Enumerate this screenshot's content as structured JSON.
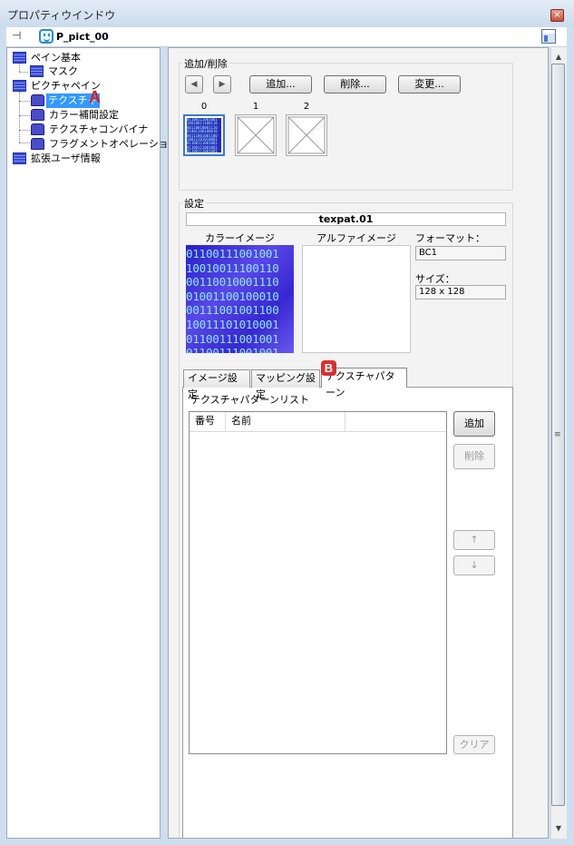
{
  "window": {
    "title": "プロパティウインドウ",
    "close_glyph": "×"
  },
  "toolbar": {
    "pin_glyph": "⊣",
    "object_name": "P_pict_00"
  },
  "tree": {
    "items": [
      {
        "label": "ペイン基本"
      },
      {
        "label": "マスク"
      },
      {
        "label": "ピクチャペイン"
      },
      {
        "label": "テクスチャ"
      },
      {
        "label": "カラー補間設定"
      },
      {
        "label": "テクスチャコンバイナ"
      },
      {
        "label": "フラグメントオペレーション"
      },
      {
        "label": "拡張ユーザ情報"
      }
    ],
    "badge_a": "A"
  },
  "add_remove": {
    "group_label": "追加/削除",
    "prev_glyph": "◀",
    "next_glyph": "▶",
    "add_button": "追加...",
    "delete_button": "削除...",
    "change_button": "変更...",
    "thumb_indices": [
      "0",
      "1",
      "2"
    ]
  },
  "settings": {
    "group_label": "設定",
    "texture_name": "texpat.01",
    "color_image_label": "カラーイメージ",
    "alpha_image_label": "アルファイメージ",
    "format_label": "フォーマット：",
    "format_value": "BC1",
    "size_label": "サイズ：",
    "size_value": "128 x 128",
    "color_image_text": "01100111001001\n10010011100110\n00110010001110\n01001100100010\n00111001001100\n10011101010001\n01100111001001\n01100111001001\n01100111001001"
  },
  "tabs": {
    "items": [
      {
        "label": "イメージ設定"
      },
      {
        "label": "マッピング設定"
      },
      {
        "label": "テクスチャパターン"
      }
    ],
    "badge_b": "B"
  },
  "pattern": {
    "list_label": "テクスチャパターンリスト",
    "col_number": "番号",
    "col_name": "名前",
    "add_button": "追加",
    "delete_button": "削除",
    "up_button": "↑",
    "down_button": "↓",
    "clear_button": "クリア"
  },
  "scrollbar": {
    "up_glyph": "▲",
    "down_glyph": "▼",
    "grip_glyph": "≡"
  }
}
